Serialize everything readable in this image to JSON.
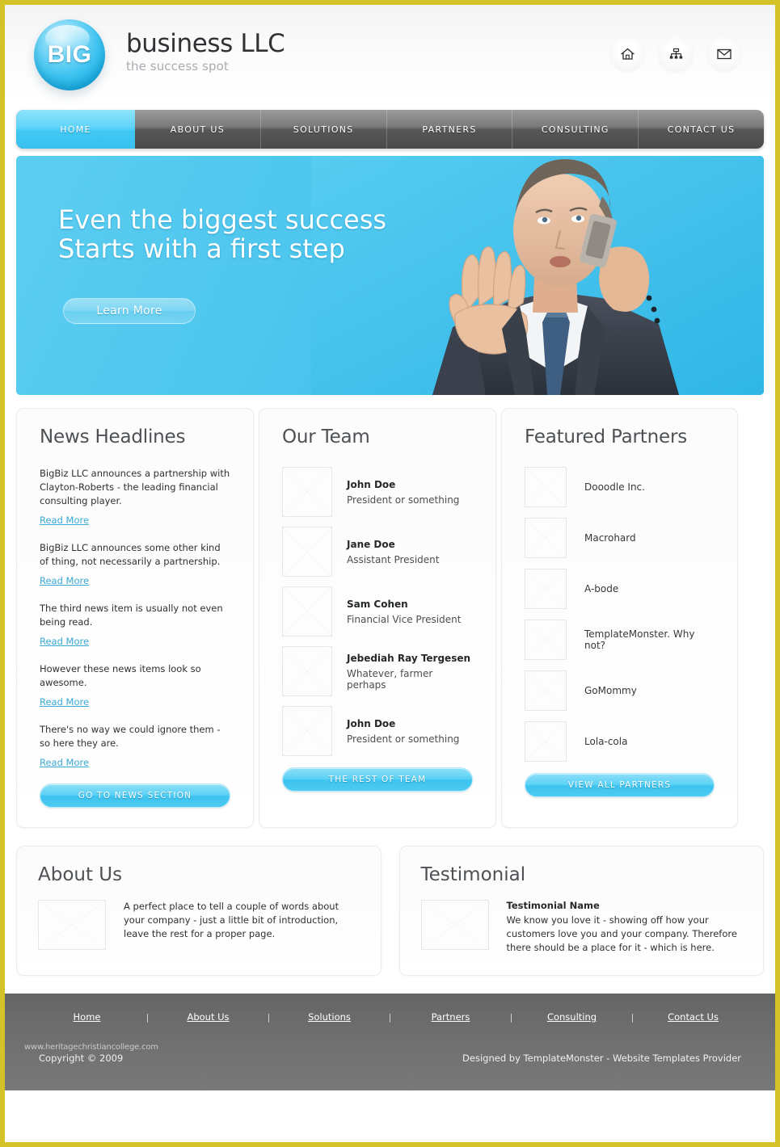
{
  "header": {
    "logo_badge": "BIG",
    "brand_name": "business LLC",
    "tagline": "the success spot",
    "icons": [
      {
        "name": "home-icon",
        "label": "Home"
      },
      {
        "name": "sitemap-icon",
        "label": "Sitemap"
      },
      {
        "name": "mail-icon",
        "label": "Contact"
      }
    ]
  },
  "nav": {
    "items": [
      {
        "label": "HOME",
        "active": true
      },
      {
        "label": "ABOUT US",
        "active": false
      },
      {
        "label": "SOLUTIONS",
        "active": false
      },
      {
        "label": "PARTNERS",
        "active": false
      },
      {
        "label": "CONSULTING",
        "active": false
      },
      {
        "label": "CONTACT US",
        "active": false
      }
    ]
  },
  "hero": {
    "title_line1": "Even the biggest success",
    "title_line2": "Starts with a first step",
    "button_label": "Learn More",
    "background_color": "#4AC6EE",
    "image_alt": "Businessman in suit talking on mobile phone"
  },
  "news": {
    "title": "News Headlines",
    "items": [
      {
        "text": "BigBiz LLC announces a partnership with Clayton-Roberts - the leading financial consulting player.",
        "link": "Read More"
      },
      {
        "text": "BigBiz LLC announces some other kind of thing, not necessarily a partnership.",
        "link": "Read More"
      },
      {
        "text": "The third news item is usually not even being read.",
        "link": "Read More"
      },
      {
        "text": "However these news items look so awesome.",
        "link": "Read More"
      },
      {
        "text": "There's no way  we could ignore them - so here they are.",
        "link": "Read More"
      }
    ],
    "button_label": "GO TO NEWS SECTION"
  },
  "team": {
    "title": "Our Team",
    "members": [
      {
        "name": "John Doe",
        "role": "President or something"
      },
      {
        "name": "Jane Doe",
        "role": "Assistant President"
      },
      {
        "name": "Sam Cohen",
        "role": "Financial Vice President"
      },
      {
        "name": "Jebediah Ray Tergesen",
        "role": "Whatever, farmer perhaps"
      },
      {
        "name": "John Doe",
        "role": "President or something"
      }
    ],
    "button_label": "THE REST OF TEAM"
  },
  "partners": {
    "title": "Featured Partners",
    "items": [
      {
        "name": "Dooodle Inc."
      },
      {
        "name": "Macrohard"
      },
      {
        "name": "A-bode"
      },
      {
        "name": "TemplateMonster. Why not?"
      },
      {
        "name": "GoMommy"
      },
      {
        "name": "Lola-cola"
      }
    ],
    "button_label": "VIEW ALL PARTNERS"
  },
  "about": {
    "title": "About Us",
    "text": "A perfect place to tell a couple of words about your company - just a little bit of introduction, leave the rest for a proper page."
  },
  "testimonial": {
    "title": "Testimonial",
    "author": "Testimonial Name",
    "text": "We know you love it - showing off how your customers love you and your company. Therefore there should be a place for it - which is here."
  },
  "footer": {
    "links": [
      "Home",
      "About Us",
      "Solutions",
      "Partners",
      "Consulting",
      "Contact Us"
    ],
    "separator": "|",
    "copyright": "Copyright © 2009",
    "watermark": "www.heritagechristiancollege.com",
    "designed_by": "Designed by TemplateMonster - Website Templates Provider"
  },
  "theme": {
    "page_border": "#D4C229",
    "accent_blue": "#45C7F0",
    "nav_gray": "#6E6E6E",
    "link_blue": "#3AA9D4"
  }
}
